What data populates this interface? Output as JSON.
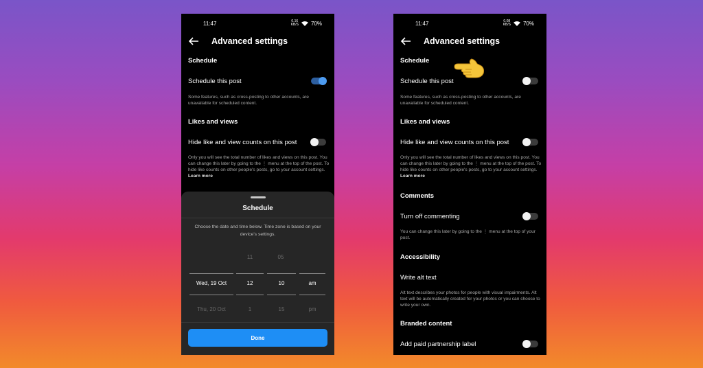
{
  "left": {
    "status": {
      "time": "11:47",
      "speed_value": "0.16",
      "speed_unit": "KB/S",
      "battery": "70%"
    },
    "title": "Advanced settings",
    "schedule_section": "Schedule",
    "schedule_row": "Schedule this post",
    "schedule_toggle_on": true,
    "schedule_desc": "Some features, such as cross-posting to other accounts, are unavailable for scheduled content.",
    "likes_section": "Likes and views",
    "hide_row": "Hide like and view counts on this post",
    "hide_desc": "Only you will see the total number of likes and views on this post. You can change this later by going to the ⋮ menu at the top of the post. To hide like counts on other people's posts, go to your account settings.",
    "learn_more": "Learn more",
    "sheet": {
      "title": "Schedule",
      "desc": "Choose the date and time below. Time zone is based on your device's settings.",
      "picker": {
        "above": [
          "",
          "11",
          "05",
          ""
        ],
        "selected": [
          "Wed, 19 Oct",
          "12",
          "10",
          "am"
        ],
        "below": [
          "Thu, 20 Oct",
          "1",
          "15",
          "pm"
        ]
      },
      "done": "Done"
    }
  },
  "right": {
    "status": {
      "time": "11:47",
      "speed_value": "0.08",
      "speed_unit": "KB/S",
      "battery": "70%"
    },
    "title": "Advanced settings",
    "schedule_section": "Schedule",
    "schedule_row": "Schedule this post",
    "schedule_desc": "Some features, such as cross-posting to other accounts, are unavailable for scheduled content.",
    "likes_section": "Likes and views",
    "hide_row": "Hide like and view counts on this post",
    "hide_desc": "Only you will see the total number of likes and views on this post. You can change this later by going to the ⋮ menu at the top of the post. To hide like counts on other people's posts, go to your account settings.",
    "learn_more": "Learn more",
    "comments_section": "Comments",
    "comments_row": "Turn off commenting",
    "comments_desc": "You can change this later by going to the ⋮ menu at the top of your post.",
    "access_section": "Accessibility",
    "alt_row": "Write alt text",
    "alt_desc": "Alt text describes your photos for people with visual impairments. Alt text will be automatically created for your photos or you can choose to write your own.",
    "branded_section": "Branded content",
    "paid_row": "Add paid partnership label"
  },
  "colors": {
    "accent": "#1e8ef5",
    "toggle_on": "#4d9bf0",
    "sheet": "#262626"
  },
  "icons": {
    "back": "arrow-left-icon",
    "wifi": "wifi-icon",
    "pointer": "pointing-hand-emoji"
  }
}
